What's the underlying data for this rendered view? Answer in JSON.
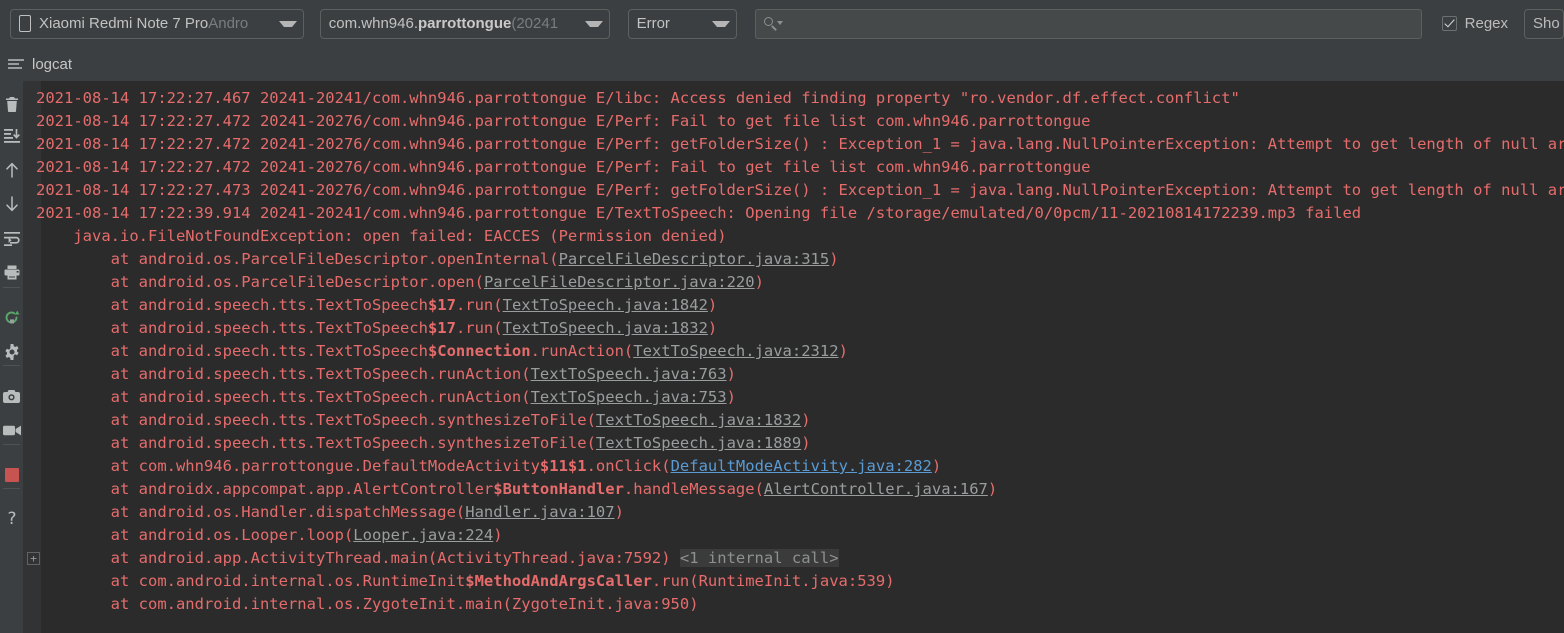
{
  "toolbar": {
    "device": {
      "icon": "phone-icon",
      "name": "Xiaomi Redmi Note 7 Pro ",
      "detail": "Andro"
    },
    "process": {
      "prefix": "com.whn946.",
      "bold": "parrottongue",
      "suffix": " (20241"
    },
    "level": {
      "value": "Error"
    },
    "search": {
      "value": "",
      "placeholder": "",
      "icon": "search-icon"
    },
    "regex": {
      "label": "Regex",
      "checked": true
    },
    "show_button": {
      "label": "Sho"
    }
  },
  "tabstrip": {
    "tab_label": "logcat",
    "tab_icon": "logcat-icon"
  },
  "rail": {
    "items": [
      {
        "name": "clear-logcat-icon",
        "title": "Clear logcat"
      },
      {
        "name": "scroll-to-end-icon",
        "title": "Scroll to the end"
      },
      {
        "name": "up-arrow-icon",
        "title": "Up the stack trace"
      },
      {
        "name": "down-arrow-icon",
        "title": "Down the stack trace"
      },
      {
        "name": "soft-wrap-icon",
        "title": "Use soft wraps"
      },
      {
        "name": "print-icon",
        "title": "Print"
      },
      {
        "name": "restart-icon",
        "title": "Restart"
      },
      {
        "name": "settings-gear-icon",
        "title": "Logcat header settings"
      },
      {
        "name": "screenshot-camera-icon",
        "title": "Screen capture"
      },
      {
        "name": "screen-record-icon",
        "title": "Screen record"
      },
      {
        "name": "stop-icon",
        "title": "Stop"
      },
      {
        "name": "help-icon",
        "title": "Help"
      }
    ]
  },
  "log": {
    "fold_marker": "+",
    "lines": [
      {
        "indent": 0,
        "parts": [
          {
            "t": "2021-08-14 17:22:27.467 20241-20241/com.whn946.parrottongue E/libc: Access denied finding property \"ro.vendor.df.effect.conflict\"",
            "s": "plain"
          }
        ]
      },
      {
        "indent": 0,
        "parts": [
          {
            "t": "2021-08-14 17:22:27.472 20241-20276/com.whn946.parrottongue E/Perf: Fail to get file list com.whn946.parrottongue",
            "s": "plain"
          }
        ]
      },
      {
        "indent": 0,
        "parts": [
          {
            "t": "2021-08-14 17:22:27.472 20241-20276/com.whn946.parrottongue E/Perf: getFolderSize() : Exception_1 = java.lang.NullPointerException: Attempt to get length of null array",
            "s": "plain"
          }
        ]
      },
      {
        "indent": 0,
        "parts": [
          {
            "t": "2021-08-14 17:22:27.472 20241-20276/com.whn946.parrottongue E/Perf: Fail to get file list com.whn946.parrottongue",
            "s": "plain"
          }
        ]
      },
      {
        "indent": 0,
        "parts": [
          {
            "t": "2021-08-14 17:22:27.473 20241-20276/com.whn946.parrottongue E/Perf: getFolderSize() : Exception_1 = java.lang.NullPointerException: Attempt to get length of null array",
            "s": "plain"
          }
        ]
      },
      {
        "indent": 0,
        "parts": [
          {
            "t": "2021-08-14 17:22:39.914 20241-20241/com.whn946.parrottongue E/TextToSpeech: Opening file /storage/emulated/0/0pcm/11-20210814172239.mp3 failed",
            "s": "plain"
          }
        ]
      },
      {
        "indent": 4,
        "parts": [
          {
            "t": "java.io.FileNotFoundException: open failed: EACCES (Permission denied)",
            "s": "plain"
          }
        ]
      },
      {
        "indent": 8,
        "parts": [
          {
            "t": "at android.os.ParcelFileDescriptor.openInternal(",
            "s": "plain"
          },
          {
            "t": "ParcelFileDescriptor.java:315",
            "s": "link"
          },
          {
            "t": ")",
            "s": "plain"
          }
        ]
      },
      {
        "indent": 8,
        "parts": [
          {
            "t": "at android.os.ParcelFileDescriptor.open(",
            "s": "plain"
          },
          {
            "t": "ParcelFileDescriptor.java:220",
            "s": "link"
          },
          {
            "t": ")",
            "s": "plain"
          }
        ]
      },
      {
        "indent": 8,
        "parts": [
          {
            "t": "at android.speech.tts.TextToSpeech",
            "s": "plain"
          },
          {
            "t": "$17",
            "s": "bold"
          },
          {
            "t": ".run(",
            "s": "plain"
          },
          {
            "t": "TextToSpeech.java:1842",
            "s": "link"
          },
          {
            "t": ")",
            "s": "plain"
          }
        ]
      },
      {
        "indent": 8,
        "parts": [
          {
            "t": "at android.speech.tts.TextToSpeech",
            "s": "plain"
          },
          {
            "t": "$17",
            "s": "bold"
          },
          {
            "t": ".run(",
            "s": "plain"
          },
          {
            "t": "TextToSpeech.java:1832",
            "s": "link"
          },
          {
            "t": ")",
            "s": "plain"
          }
        ]
      },
      {
        "indent": 8,
        "parts": [
          {
            "t": "at android.speech.tts.TextToSpeech",
            "s": "plain"
          },
          {
            "t": "$Connection",
            "s": "bold"
          },
          {
            "t": ".runAction(",
            "s": "plain"
          },
          {
            "t": "TextToSpeech.java:2312",
            "s": "link"
          },
          {
            "t": ")",
            "s": "plain"
          }
        ]
      },
      {
        "indent": 8,
        "parts": [
          {
            "t": "at android.speech.tts.TextToSpeech.runAction(",
            "s": "plain"
          },
          {
            "t": "TextToSpeech.java:763",
            "s": "link"
          },
          {
            "t": ")",
            "s": "plain"
          }
        ]
      },
      {
        "indent": 8,
        "parts": [
          {
            "t": "at android.speech.tts.TextToSpeech.runAction(",
            "s": "plain"
          },
          {
            "t": "TextToSpeech.java:753",
            "s": "link"
          },
          {
            "t": ")",
            "s": "plain"
          }
        ]
      },
      {
        "indent": 8,
        "parts": [
          {
            "t": "at android.speech.tts.TextToSpeech.synthesizeToFile(",
            "s": "plain"
          },
          {
            "t": "TextToSpeech.java:1832",
            "s": "link"
          },
          {
            "t": ")",
            "s": "plain"
          }
        ]
      },
      {
        "indent": 8,
        "parts": [
          {
            "t": "at android.speech.tts.TextToSpeech.synthesizeToFile(",
            "s": "plain"
          },
          {
            "t": "TextToSpeech.java:1889",
            "s": "link"
          },
          {
            "t": ")",
            "s": "plain"
          }
        ]
      },
      {
        "indent": 8,
        "parts": [
          {
            "t": "at com.whn946.parrottongue.DefaultModeActivity",
            "s": "plain"
          },
          {
            "t": "$11$1",
            "s": "bold"
          },
          {
            "t": ".onClick(",
            "s": "plain"
          },
          {
            "t": "DefaultModeActivity.java:282",
            "s": "link-blue"
          },
          {
            "t": ")",
            "s": "plain"
          }
        ]
      },
      {
        "indent": 8,
        "parts": [
          {
            "t": "at androidx.appcompat.app.AlertController",
            "s": "plain"
          },
          {
            "t": "$ButtonHandler",
            "s": "bold"
          },
          {
            "t": ".handleMessage(",
            "s": "plain"
          },
          {
            "t": "AlertController.java:167",
            "s": "link"
          },
          {
            "t": ")",
            "s": "plain"
          }
        ]
      },
      {
        "indent": 8,
        "parts": [
          {
            "t": "at android.os.Handler.dispatchMessage(",
            "s": "plain"
          },
          {
            "t": "Handler.java:107",
            "s": "link"
          },
          {
            "t": ")",
            "s": "plain"
          }
        ]
      },
      {
        "indent": 8,
        "parts": [
          {
            "t": "at android.os.Looper.loop(",
            "s": "plain"
          },
          {
            "t": "Looper.java:224",
            "s": "link"
          },
          {
            "t": ")",
            "s": "plain"
          }
        ]
      },
      {
        "indent": 8,
        "parts": [
          {
            "t": "at android.app.ActivityThread.main(ActivityThread.java:7592) ",
            "s": "plain"
          },
          {
            "t": "<1 internal call>",
            "s": "internal"
          }
        ]
      },
      {
        "indent": 8,
        "parts": [
          {
            "t": "at com.android.internal.os.RuntimeInit",
            "s": "plain"
          },
          {
            "t": "$MethodAndArgsCaller",
            "s": "bold"
          },
          {
            "t": ".run(RuntimeInit.java:539)",
            "s": "plain"
          }
        ]
      },
      {
        "indent": 8,
        "parts": [
          {
            "t": "at com.android.internal.os.ZygoteInit.main(ZygoteInit.java:950)",
            "s": "plain"
          }
        ]
      }
    ]
  },
  "colors": {
    "chrome_bg": "#3c3f41",
    "log_bg": "#2b2b2b",
    "gutter_bg": "#313335",
    "error_text": "#e66c6c",
    "link": "#9a9d9e",
    "link_active": "#5a9bd5",
    "accent_green": "#59a869",
    "stop_red": "#c75450"
  }
}
